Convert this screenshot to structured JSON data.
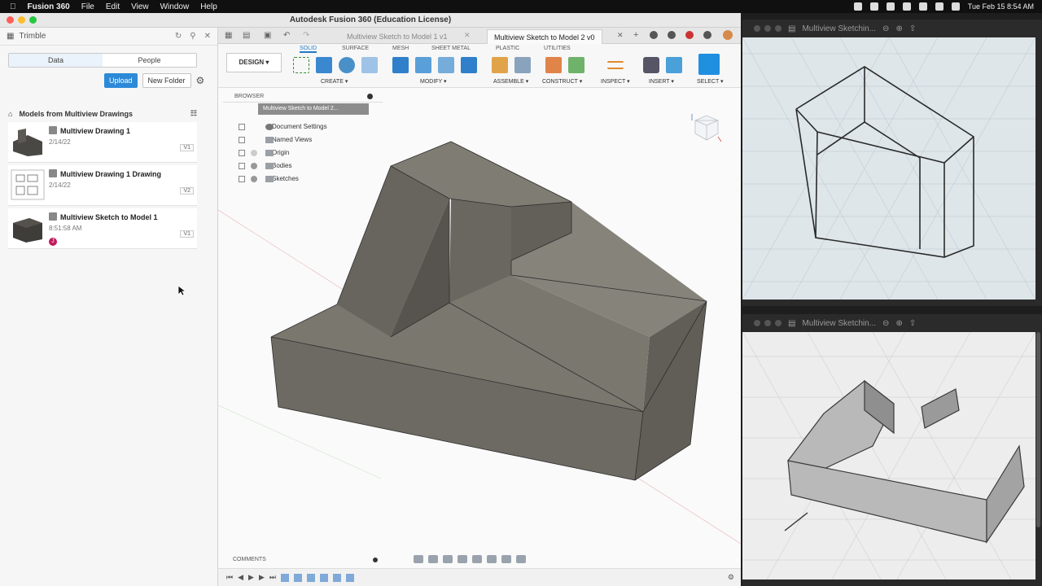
{
  "menubar": {
    "app_name": "Fusion 360",
    "items": [
      "File",
      "Edit",
      "View",
      "Window",
      "Help"
    ],
    "clock": "Tue Feb 15  8:54 AM"
  },
  "window": {
    "title": "Autodesk Fusion 360 (Education License)"
  },
  "data_panel": {
    "team_name": "Trimble",
    "tabs": [
      "Data",
      "People"
    ],
    "active_tab": "Data",
    "upload_label": "Upload",
    "new_folder_label": "New Folder",
    "breadcrumb": "Models from Multiview Drawings",
    "files": [
      {
        "name": "Multiview Drawing 1",
        "date": "2/14/22",
        "version": "V1"
      },
      {
        "name": "Multiview Drawing 1 Drawing",
        "date": "2/14/22",
        "version": "V2"
      },
      {
        "name": "Multiview Sketch to Model 1",
        "date": "8:51:58 AM",
        "version": "V1",
        "badge": "J"
      }
    ]
  },
  "doc_tabs": [
    {
      "label": "Multiview Sketch to Model 1 v1",
      "active": false
    },
    {
      "label": "Multiview Sketch to Model 2 v0",
      "active": true
    }
  ],
  "toolbar": {
    "workspace": "DESIGN",
    "workspace_tabs": [
      "SOLID",
      "SURFACE",
      "MESH",
      "SHEET METAL",
      "PLASTIC",
      "UTILITIES"
    ],
    "active_workspace_tab": "SOLID",
    "groups": [
      "CREATE",
      "MODIFY",
      "ASSEMBLE",
      "CONSTRUCT",
      "INSPECT",
      "INSERT",
      "SELECT"
    ]
  },
  "browser": {
    "header": "BROWSER",
    "root": "Multiview Sketch to Model 2...",
    "items": [
      "Document Settings",
      "Named Views",
      "Origin",
      "Bodies",
      "Sketches"
    ]
  },
  "comments_label": "COMMENTS",
  "reference_windows": [
    {
      "title": "Multiview Sketchin..."
    },
    {
      "title": "Multiview Sketchin..."
    }
  ],
  "colors": {
    "accent": "#2d8ad8",
    "model_face_top": "#7d7a72",
    "model_face_side": "#6b6861",
    "model_face_dark": "#5e5b55"
  }
}
